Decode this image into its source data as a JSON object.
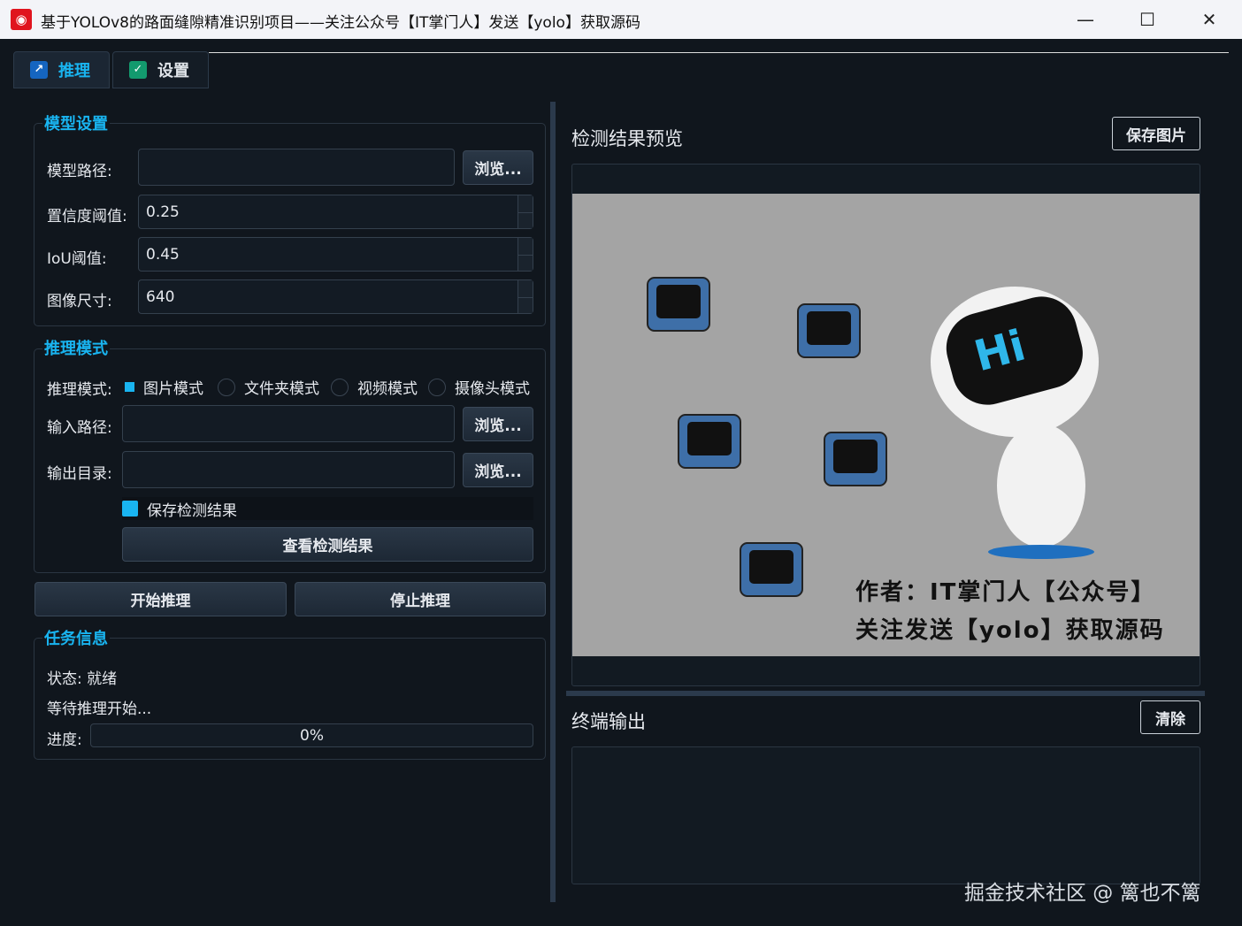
{
  "window": {
    "title": "基于YOLOv8的路面缝隙精准识别项目——关注公众号【IT掌门人】发送【yolo】获取源码",
    "minimize": "—",
    "maximize": "☐",
    "close": "✕"
  },
  "tabs": [
    {
      "label": "推理",
      "icon": "chart-icon"
    },
    {
      "label": "设置",
      "icon": "check-circle-icon"
    }
  ],
  "model": {
    "title": "模型设置",
    "path_label": "模型路径:",
    "path_value": "",
    "browse": "浏览...",
    "conf_label": "置信度阈值:",
    "conf_value": "0.25",
    "iou_label": "IoU阈值:",
    "iou_value": "0.45",
    "size_label": "图像尺寸:",
    "size_value": "640"
  },
  "mode": {
    "title": "推理模式",
    "mode_label": "推理模式:",
    "options": [
      "图片模式",
      "文件夹模式",
      "视频模式",
      "摄像头模式"
    ],
    "selected": "图片模式",
    "input_label": "输入路径:",
    "output_label": "输出目录:",
    "browse": "浏览...",
    "save_label": "保存检测结果",
    "save_checked": true,
    "view_button": "查看检测结果"
  },
  "actions": {
    "start": "开始推理",
    "stop": "停止推理"
  },
  "task": {
    "title": "任务信息",
    "status": "状态: 就绪",
    "message": "等待推理开始...",
    "progress_label": "进度:",
    "progress_text": "0%",
    "progress": 0
  },
  "preview": {
    "title": "检测结果预览",
    "save_button": "保存图片",
    "image_text_1": "作者：IT掌门人【公众号】",
    "image_text_2": "关注发送【yolo】获取源码",
    "robot_text": "Hi"
  },
  "terminal": {
    "title": "终端输出",
    "clear_button": "清除",
    "content": ""
  },
  "watermark": "掘金技术社区 @ 篱也不篱"
}
